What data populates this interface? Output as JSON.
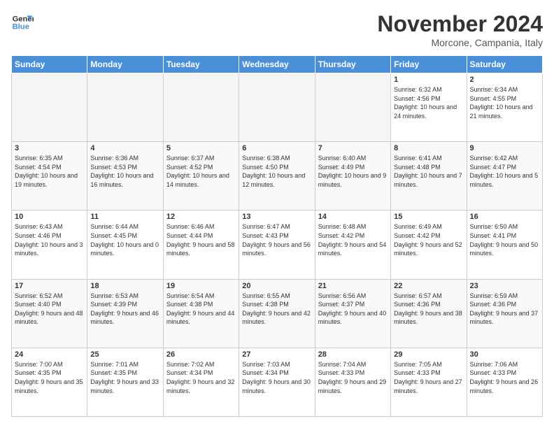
{
  "logo": {
    "line1": "General",
    "line2": "Blue"
  },
  "header": {
    "title": "November 2024",
    "location": "Morcone, Campania, Italy"
  },
  "weekdays": [
    "Sunday",
    "Monday",
    "Tuesday",
    "Wednesday",
    "Thursday",
    "Friday",
    "Saturday"
  ],
  "weeks": [
    [
      {
        "day": "",
        "info": ""
      },
      {
        "day": "",
        "info": ""
      },
      {
        "day": "",
        "info": ""
      },
      {
        "day": "",
        "info": ""
      },
      {
        "day": "",
        "info": ""
      },
      {
        "day": "1",
        "info": "Sunrise: 6:32 AM\nSunset: 4:56 PM\nDaylight: 10 hours and 24 minutes."
      },
      {
        "day": "2",
        "info": "Sunrise: 6:34 AM\nSunset: 4:55 PM\nDaylight: 10 hours and 21 minutes."
      }
    ],
    [
      {
        "day": "3",
        "info": "Sunrise: 6:35 AM\nSunset: 4:54 PM\nDaylight: 10 hours and 19 minutes."
      },
      {
        "day": "4",
        "info": "Sunrise: 6:36 AM\nSunset: 4:53 PM\nDaylight: 10 hours and 16 minutes."
      },
      {
        "day": "5",
        "info": "Sunrise: 6:37 AM\nSunset: 4:52 PM\nDaylight: 10 hours and 14 minutes."
      },
      {
        "day": "6",
        "info": "Sunrise: 6:38 AM\nSunset: 4:50 PM\nDaylight: 10 hours and 12 minutes."
      },
      {
        "day": "7",
        "info": "Sunrise: 6:40 AM\nSunset: 4:49 PM\nDaylight: 10 hours and 9 minutes."
      },
      {
        "day": "8",
        "info": "Sunrise: 6:41 AM\nSunset: 4:48 PM\nDaylight: 10 hours and 7 minutes."
      },
      {
        "day": "9",
        "info": "Sunrise: 6:42 AM\nSunset: 4:47 PM\nDaylight: 10 hours and 5 minutes."
      }
    ],
    [
      {
        "day": "10",
        "info": "Sunrise: 6:43 AM\nSunset: 4:46 PM\nDaylight: 10 hours and 3 minutes."
      },
      {
        "day": "11",
        "info": "Sunrise: 6:44 AM\nSunset: 4:45 PM\nDaylight: 10 hours and 0 minutes."
      },
      {
        "day": "12",
        "info": "Sunrise: 6:46 AM\nSunset: 4:44 PM\nDaylight: 9 hours and 58 minutes."
      },
      {
        "day": "13",
        "info": "Sunrise: 6:47 AM\nSunset: 4:43 PM\nDaylight: 9 hours and 56 minutes."
      },
      {
        "day": "14",
        "info": "Sunrise: 6:48 AM\nSunset: 4:42 PM\nDaylight: 9 hours and 54 minutes."
      },
      {
        "day": "15",
        "info": "Sunrise: 6:49 AM\nSunset: 4:42 PM\nDaylight: 9 hours and 52 minutes."
      },
      {
        "day": "16",
        "info": "Sunrise: 6:50 AM\nSunset: 4:41 PM\nDaylight: 9 hours and 50 minutes."
      }
    ],
    [
      {
        "day": "17",
        "info": "Sunrise: 6:52 AM\nSunset: 4:40 PM\nDaylight: 9 hours and 48 minutes."
      },
      {
        "day": "18",
        "info": "Sunrise: 6:53 AM\nSunset: 4:39 PM\nDaylight: 9 hours and 46 minutes."
      },
      {
        "day": "19",
        "info": "Sunrise: 6:54 AM\nSunset: 4:38 PM\nDaylight: 9 hours and 44 minutes."
      },
      {
        "day": "20",
        "info": "Sunrise: 6:55 AM\nSunset: 4:38 PM\nDaylight: 9 hours and 42 minutes."
      },
      {
        "day": "21",
        "info": "Sunrise: 6:56 AM\nSunset: 4:37 PM\nDaylight: 9 hours and 40 minutes."
      },
      {
        "day": "22",
        "info": "Sunrise: 6:57 AM\nSunset: 4:36 PM\nDaylight: 9 hours and 38 minutes."
      },
      {
        "day": "23",
        "info": "Sunrise: 6:59 AM\nSunset: 4:36 PM\nDaylight: 9 hours and 37 minutes."
      }
    ],
    [
      {
        "day": "24",
        "info": "Sunrise: 7:00 AM\nSunset: 4:35 PM\nDaylight: 9 hours and 35 minutes."
      },
      {
        "day": "25",
        "info": "Sunrise: 7:01 AM\nSunset: 4:35 PM\nDaylight: 9 hours and 33 minutes."
      },
      {
        "day": "26",
        "info": "Sunrise: 7:02 AM\nSunset: 4:34 PM\nDaylight: 9 hours and 32 minutes."
      },
      {
        "day": "27",
        "info": "Sunrise: 7:03 AM\nSunset: 4:34 PM\nDaylight: 9 hours and 30 minutes."
      },
      {
        "day": "28",
        "info": "Sunrise: 7:04 AM\nSunset: 4:33 PM\nDaylight: 9 hours and 29 minutes."
      },
      {
        "day": "29",
        "info": "Sunrise: 7:05 AM\nSunset: 4:33 PM\nDaylight: 9 hours and 27 minutes."
      },
      {
        "day": "30",
        "info": "Sunrise: 7:06 AM\nSunset: 4:33 PM\nDaylight: 9 hours and 26 minutes."
      }
    ]
  ]
}
